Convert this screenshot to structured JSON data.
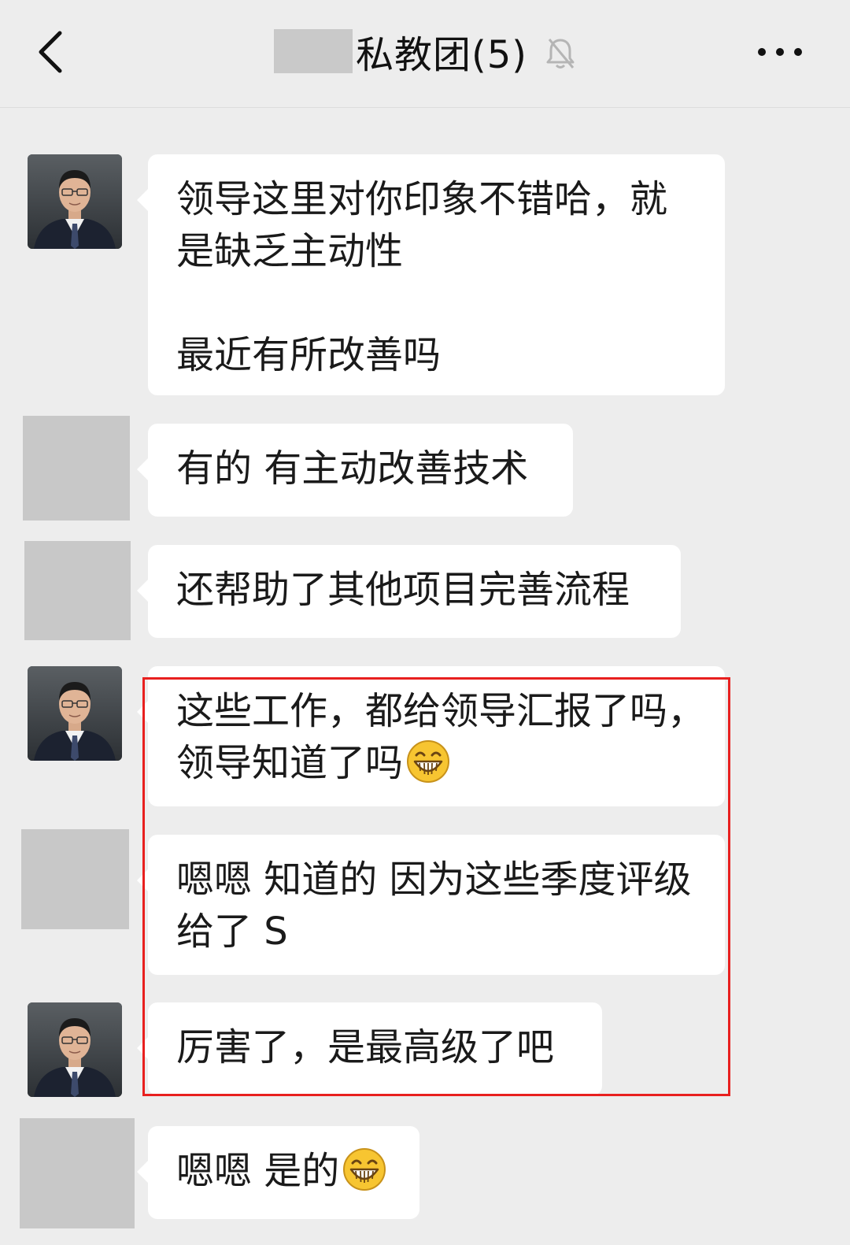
{
  "header": {
    "title": "私教团(5)",
    "back_icon": "chevron-left-icon",
    "mute_icon": "bell-off-icon",
    "more_icon": "more-dots-icon"
  },
  "messages": [
    {
      "sender": "coach",
      "lines": [
        "领导这里对你印象不错哈，就",
        "是缺乏主动性",
        "",
        "最近有所改善吗"
      ]
    },
    {
      "sender": "member",
      "lines": [
        "有的 有主动改善技术"
      ]
    },
    {
      "sender": "member",
      "lines": [
        "还帮助了其他项目完善流程"
      ]
    },
    {
      "sender": "coach",
      "lines": [
        "这些工作，都给领导汇报了吗，",
        "领导知道了吗"
      ],
      "emoji": "grin-emoji"
    },
    {
      "sender": "member",
      "lines": [
        "嗯嗯 知道的 因为这些季度评级",
        "给了 S"
      ]
    },
    {
      "sender": "coach",
      "lines": [
        "厉害了，是最高级了吧"
      ]
    },
    {
      "sender": "member",
      "lines": [
        "嗯嗯 是的"
      ],
      "emoji": "grin-emoji"
    }
  ],
  "colors": {
    "background": "#ededed",
    "bubble": "#ffffff",
    "highlight": "#e8201f",
    "placeholder_avatar": "#c8c8c8"
  }
}
